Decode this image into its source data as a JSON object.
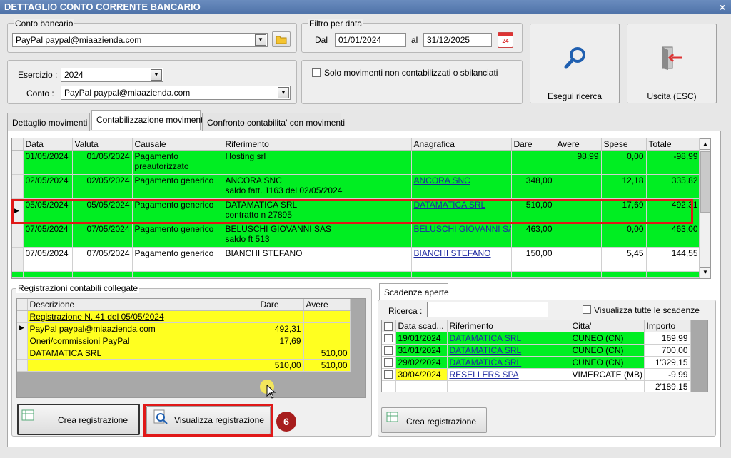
{
  "window": {
    "title": "DETTAGLIO CONTO CORRENTE BANCARIO",
    "close": "×"
  },
  "conto_bancario": {
    "legend": "Conto bancario",
    "value": "PayPal paypal@miaazienda.com"
  },
  "filtro": {
    "legend": "Filtro per data",
    "dal_label": "Dal",
    "dal": "01/01/2024",
    "al_label": "al",
    "al": "31/12/2025",
    "cal_day": "24"
  },
  "esercizio": {
    "label": "Esercizio :",
    "value": "2024",
    "conto_label": "Conto :",
    "conto_value": "PayPal paypal@miaazienda.com"
  },
  "solo_mov": {
    "label": "Solo movimenti non contabilizzati o sbilanciati"
  },
  "buttons": {
    "search": "Esegui ricerca",
    "exit": "Uscita (ESC)"
  },
  "tabs": [
    "Dettaglio movimenti",
    "Contabilizzazione movimenti",
    "Confronto contabilita' con movimenti"
  ],
  "movements": {
    "columns": [
      "Data",
      "Valuta",
      "Causale",
      "Riferimento",
      "Anagrafica",
      "Dare",
      "Avere",
      "Spese",
      "Totale"
    ],
    "rows": [
      {
        "data": "01/05/2024",
        "valuta": "01/05/2024",
        "causale": "Pagamento",
        "causale2": "preautorizzato",
        "rif": "Hosting srl",
        "rif2": "",
        "anagrafica": "",
        "dare": "",
        "avere": "98,99",
        "spese": "0,00",
        "totale": "-98,99",
        "color": "green"
      },
      {
        "data": "02/05/2024",
        "valuta": "02/05/2024",
        "causale": "Pagamento generico",
        "causale2": "",
        "rif": "ANCORA SNC",
        "rif2": "saldo fatt.    1163 del 02/05/2024",
        "anagrafica": "ANCORA SNC",
        "dare": "348,00",
        "avere": "",
        "spese": "12,18",
        "totale": "335,82",
        "color": "green"
      },
      {
        "data": "05/05/2024",
        "valuta": "05/05/2024",
        "causale": "Pagamento generico",
        "causale2": "",
        "rif": "DATAMATICA SRL",
        "rif2": "contratto n 27895",
        "anagrafica": "DATAMATICA SRL",
        "dare": "510,00",
        "avere": "",
        "spese": "17,69",
        "totale": "492,31",
        "color": "green"
      },
      {
        "data": "07/05/2024",
        "valuta": "07/05/2024",
        "causale": "Pagamento generico",
        "causale2": "",
        "rif": "BELUSCHI GIOVANNI SAS",
        "rif2": "saldo ft 513",
        "anagrafica": "BELUSCHI GIOVANNI SAS",
        "dare": "463,00",
        "avere": "",
        "spese": "0,00",
        "totale": "463,00",
        "color": "green"
      },
      {
        "data": "07/05/2024",
        "valuta": "07/05/2024",
        "causale": "Pagamento generico",
        "causale2": "",
        "rif": "BIANCHI STEFANO",
        "rif2": "",
        "anagrafica": "BIANCHI STEFANO",
        "dare": "150,00",
        "avere": "",
        "spese": "5,45",
        "totale": "144,55",
        "color": "white"
      }
    ]
  },
  "registrazioni": {
    "legend": "Registrazioni contabili collegate",
    "columns": [
      "Descrizione",
      "Dare",
      "Avere"
    ],
    "rows": [
      {
        "descr": "Registrazione N. 41 del 05/05/2024",
        "dare": "",
        "avere": "",
        "link": true
      },
      {
        "descr": "PayPal paypal@miaazienda.com",
        "dare": "492,31",
        "avere": "",
        "link": false
      },
      {
        "descr": "Oneri/commissioni PayPal",
        "dare": "17,69",
        "avere": "",
        "link": false
      },
      {
        "descr": "DATAMATICA SRL",
        "dare": "",
        "avere": "510,00",
        "link": true
      },
      {
        "descr": "",
        "dare": "510,00",
        "avere": "510,00",
        "link": false
      }
    ],
    "crea": "Crea registrazione",
    "visualizza": "Visualizza registrazione",
    "step_badge": "6"
  },
  "scadenze": {
    "tab": "Scadenze aperte",
    "ricerca_label": "Ricerca :",
    "visualizza_tutte": "Visualizza tutte le scadenze",
    "columns": [
      "Data scad...",
      "Riferimento",
      "Citta'",
      "Importo"
    ],
    "rows": [
      {
        "data": "19/01/2024",
        "rif": "DATAMATICA SRL",
        "citta": "CUNEO (CN)",
        "importo": "169,99",
        "color": "green"
      },
      {
        "data": "31/01/2024",
        "rif": "DATAMATICA SRL",
        "citta": "CUNEO (CN)",
        "importo": "700,00",
        "color": "green"
      },
      {
        "data": "29/02/2024",
        "rif": "DATAMATICA SRL",
        "citta": "CUNEO (CN)",
        "importo": "1'329,15",
        "color": "green"
      },
      {
        "data": "30/04/2024",
        "rif": "RESELLERS SPA",
        "citta": "VIMERCATE (MB)",
        "importo": "-9,99",
        "color": "yellow"
      }
    ],
    "total": "2'189,15",
    "crea": "Crea registrazione"
  }
}
